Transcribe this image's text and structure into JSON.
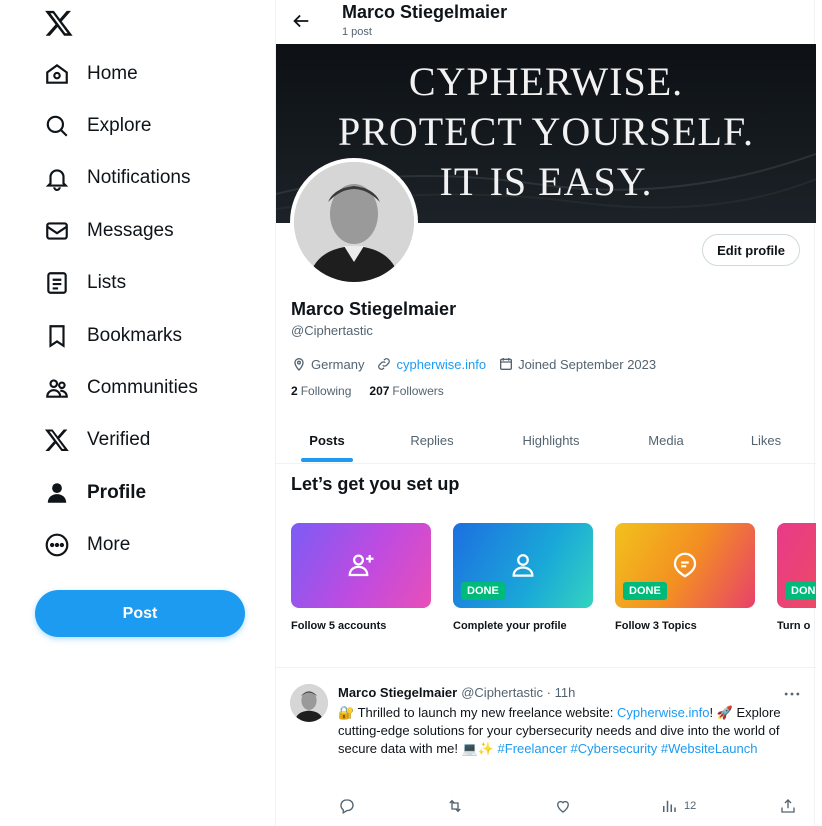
{
  "nav": {
    "items": [
      {
        "label": "Home",
        "icon": "home-icon"
      },
      {
        "label": "Explore",
        "icon": "search-icon"
      },
      {
        "label": "Notifications",
        "icon": "bell-icon"
      },
      {
        "label": "Messages",
        "icon": "mail-icon"
      },
      {
        "label": "Lists",
        "icon": "list-icon"
      },
      {
        "label": "Bookmarks",
        "icon": "bookmark-icon"
      },
      {
        "label": "Communities",
        "icon": "communities-icon"
      },
      {
        "label": "Verified",
        "icon": "x-logo-icon"
      },
      {
        "label": "Profile",
        "icon": "person-icon"
      },
      {
        "label": "More",
        "icon": "more-circle-icon"
      }
    ],
    "post_label": "Post"
  },
  "header": {
    "name": "Marco Stiegelmaier",
    "post_count": "1 post"
  },
  "banner": {
    "lines": [
      "CYPHERWISE.",
      "PROTECT YOURSELF.",
      "IT IS EASY."
    ]
  },
  "profile": {
    "name": "Marco Stiegelmaier",
    "handle": "@Ciphertastic",
    "location": "Germany",
    "website": "cypherwise.info",
    "joined": "Joined September 2023",
    "following_count": "2",
    "following_label": "Following",
    "followers_count": "207",
    "followers_label": "Followers",
    "edit_label": "Edit profile"
  },
  "tabs": [
    "Posts",
    "Replies",
    "Highlights",
    "Media",
    "Likes"
  ],
  "setup": {
    "title": "Let’s get you set up",
    "cards": [
      {
        "label": "Follow 5 accounts",
        "done": ""
      },
      {
        "label": "Complete your profile",
        "done": "DONE"
      },
      {
        "label": "Follow 3 Topics",
        "done": "DONE"
      },
      {
        "label": "Turn o",
        "done": "DONE"
      }
    ]
  },
  "tweet": {
    "name": "Marco Stiegelmaier",
    "handle_time": "@Ciphertastic · 11h",
    "text_1": "🔐 Thrilled to launch my new freelance website: ",
    "link": "Cypherwise.info",
    "text_2": "! 🚀 Explore cutting-edge solutions for your cybersecurity needs and dive into the world of secure data with me! 💻✨ ",
    "hashtag_1": "#Freelancer",
    "hashtag_2": "#Cybersecurity",
    "hashtag_3": "#WebsiteLaunch",
    "views": "12"
  },
  "colors": {
    "accent": "#1d9bf0",
    "done": "#00ba7c",
    "text": "#0f1419",
    "muted": "#536471"
  }
}
